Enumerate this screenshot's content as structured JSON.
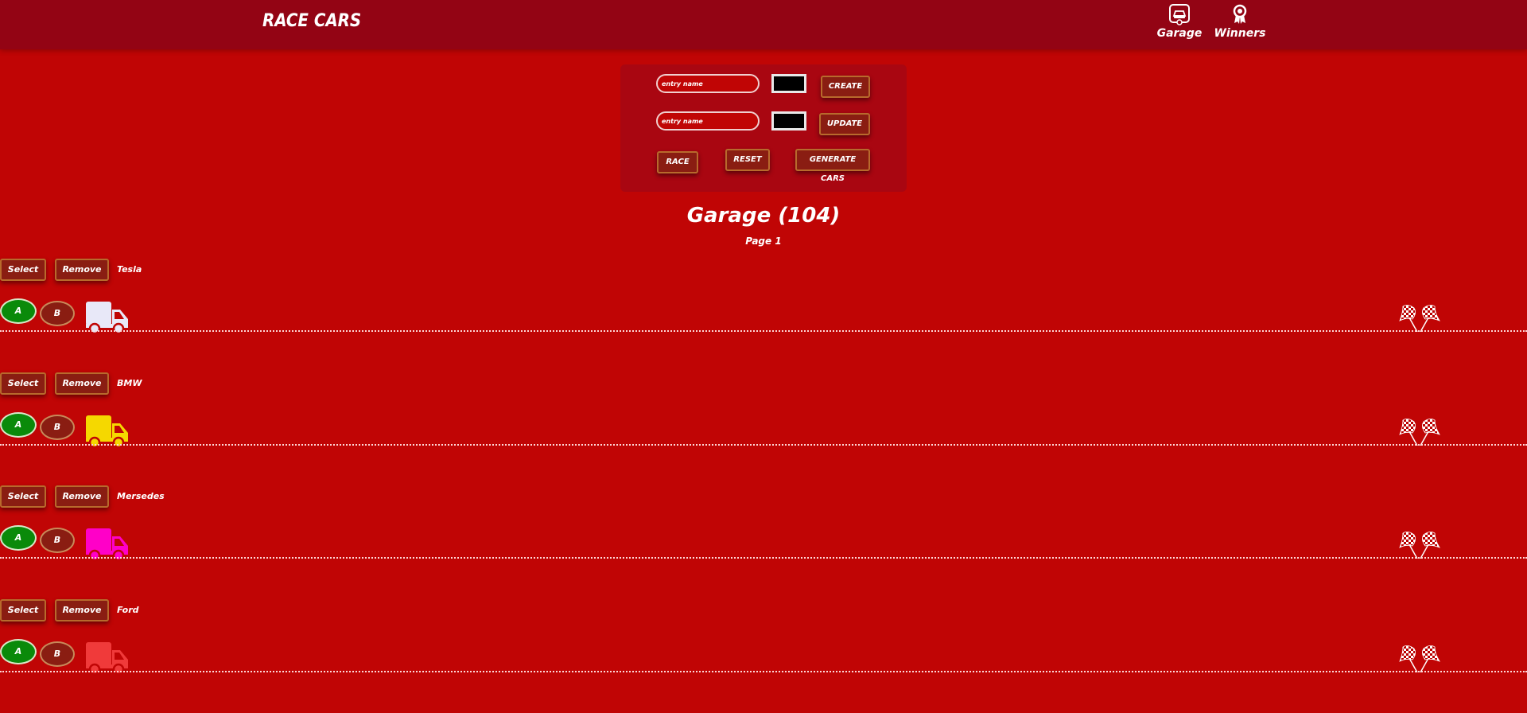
{
  "header": {
    "logo": "RACE CARS",
    "nav": [
      {
        "label": "Garage",
        "icon": "garage-icon"
      },
      {
        "label": "Winners",
        "icon": "award-icon"
      }
    ]
  },
  "controls": {
    "create": {
      "placeholder": "entry name",
      "color": "#000000",
      "button": "CREATE"
    },
    "update": {
      "placeholder": "entry name",
      "color": "#000000",
      "button": "UPDATE"
    },
    "race_button": "RACE",
    "reset_button": "RESET",
    "generate_button": "GENERATE CARS"
  },
  "garage": {
    "title": "Garage (104)",
    "page": "Page 1"
  },
  "cars": [
    {
      "name": "Tesla",
      "color": "#e8e8f8",
      "select": "Select",
      "remove": "Remove",
      "a": "A",
      "b": "B"
    },
    {
      "name": "BMW",
      "color": "#f5d800",
      "select": "Select",
      "remove": "Remove",
      "a": "A",
      "b": "B"
    },
    {
      "name": "Mersedes",
      "color": "#ff00c8",
      "select": "Select",
      "remove": "Remove",
      "a": "A",
      "b": "B"
    },
    {
      "name": "Ford",
      "color": "#f03a3a",
      "select": "Select",
      "remove": "Remove",
      "a": "A",
      "b": "B"
    }
  ],
  "colors": {
    "background": "#c00505",
    "header": "#930414",
    "panel": "#a90611",
    "button": "#8a1d12",
    "start_button": "#0a8a0a"
  }
}
